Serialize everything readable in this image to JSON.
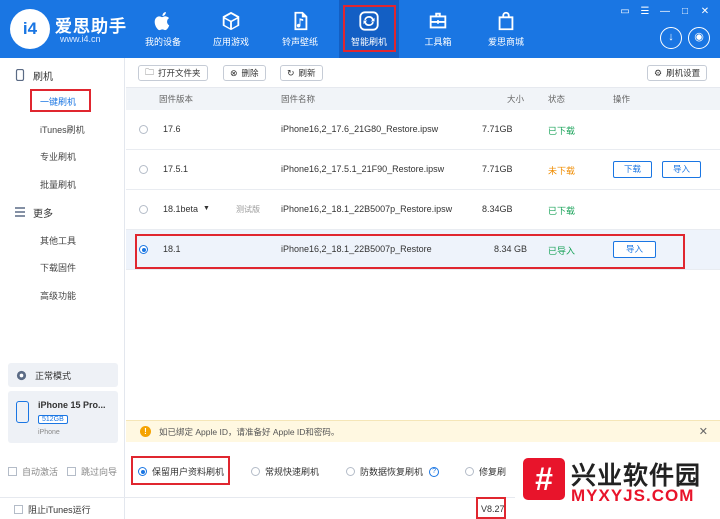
{
  "app": {
    "brand": "爱思助手",
    "url": "www.i4.cn",
    "logo_text": "i4"
  },
  "nav": {
    "items": [
      {
        "label": "我的设备",
        "icon": "apple-icon"
      },
      {
        "label": "应用游戏",
        "icon": "cube-icon"
      },
      {
        "label": "铃声壁纸",
        "icon": "music-file-icon"
      },
      {
        "label": "智能刷机",
        "icon": "refresh-box-icon"
      },
      {
        "label": "工具箱",
        "icon": "toolbox-icon"
      },
      {
        "label": "爱思商城",
        "icon": "shopping-bag-icon"
      }
    ],
    "active": "智能刷机"
  },
  "sidebar": {
    "section_flash": "刷机",
    "items_flash": [
      "一键刷机",
      "iTunes刷机",
      "专业刷机",
      "批量刷机"
    ],
    "section_more": "更多",
    "items_more": [
      "其他工具",
      "下载固件",
      "高级功能"
    ],
    "mode": "正常模式",
    "device_name": "iPhone 15 Pro...",
    "device_capacity": "512GB",
    "device_type": "iPhone"
  },
  "toolbar": {
    "open_folder": "打开文件夹",
    "delete": "删除",
    "refresh": "刷新",
    "settings": "刷机设置"
  },
  "table": {
    "headers": {
      "version": "固件版本",
      "name": "固件名称",
      "size": "大小",
      "status": "状态",
      "action": "操作"
    },
    "rows": [
      {
        "version": "17.6",
        "tag": "",
        "name": "iPhone16,2_17.6_21G80_Restore.ipsw",
        "size": "7.71GB",
        "status": "已下载",
        "status_color": "#1aa35a",
        "buttons": []
      },
      {
        "version": "17.5.1",
        "tag": "",
        "name": "iPhone16,2_17.5.1_21F90_Restore.ipsw",
        "size": "7.71GB",
        "status": "未下载",
        "status_color": "#f08c00",
        "buttons": [
          "下载",
          "导入"
        ]
      },
      {
        "version": "18.1beta",
        "tag": "测试版",
        "name": "iPhone16,2_18.1_22B5007p_Restore.ipsw",
        "size": "8.34GB",
        "status": "已下载",
        "status_color": "#1aa35a",
        "buttons": []
      },
      {
        "version": "18.1",
        "tag": "",
        "name": "iPhone16,2_18.1_22B5007p_Restore",
        "size": "8.34 GB",
        "status": "已导入",
        "status_color": "#1aa35a",
        "buttons": [
          "导入"
        ]
      }
    ]
  },
  "notice": {
    "text": "如已绑定 Apple ID，请准备好 Apple ID和密码。"
  },
  "options": {
    "auto_activate": "自动激活",
    "skip_guide": "跳过向导",
    "keep_data": "保留用户资料刷机",
    "quick_flash": "常规快速刷机",
    "anti_recovery": "防数据恢复刷机",
    "repair": "修复刷"
  },
  "statusbar": {
    "block_itunes": "阻止iTunes运行",
    "version": "V8.27"
  },
  "watermark": {
    "title": "兴业软件园",
    "url": "MYXYJS.COM"
  }
}
